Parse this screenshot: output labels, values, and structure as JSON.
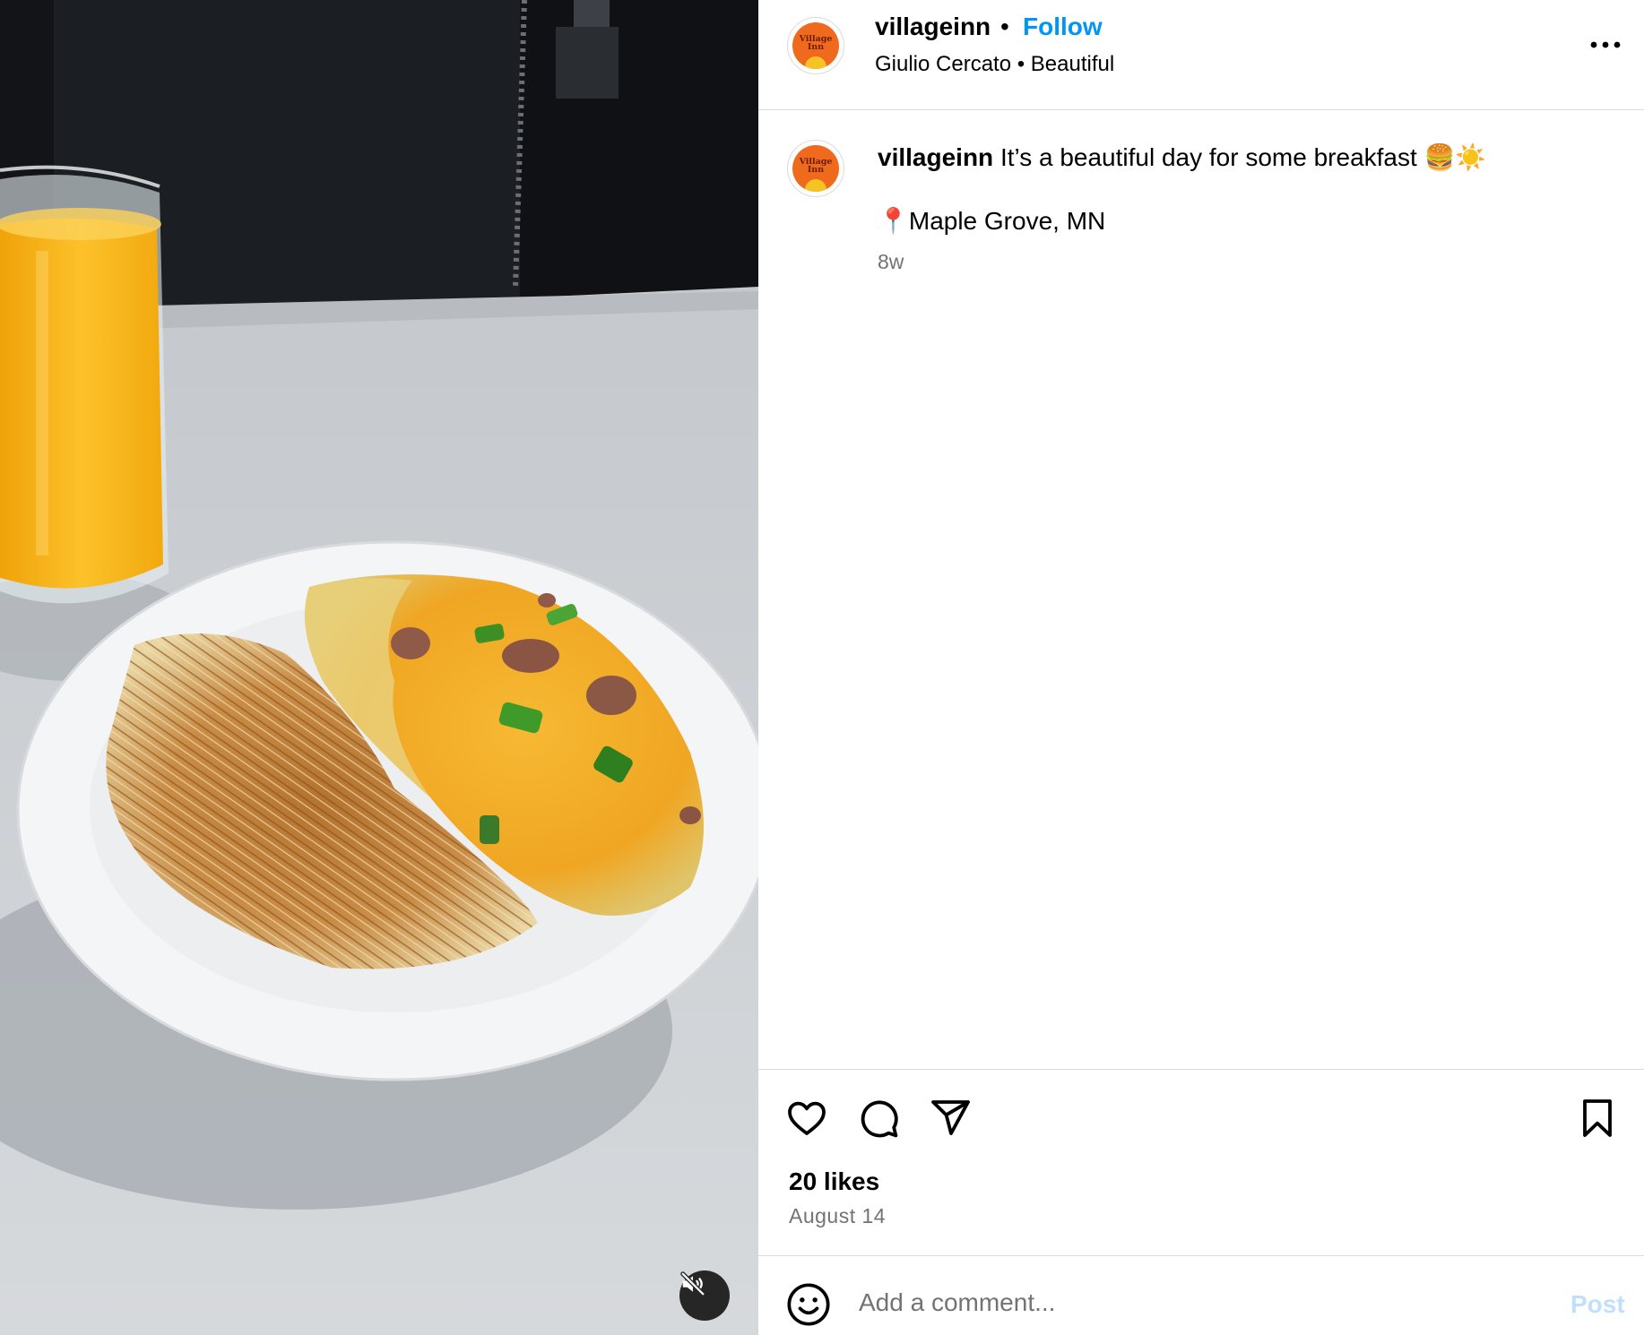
{
  "post": {
    "username": "villageinn",
    "follow_label": "Follow",
    "separator": "•",
    "audio": "Giulio Cercato • Beautiful",
    "avatar_logo_text": "Village Inn"
  },
  "caption": {
    "username": "villageinn",
    "text": "It’s a beautiful day for some breakfast 🍔☀️",
    "location": "📍Maple Grove, MN",
    "time_ago": "8w"
  },
  "engagement": {
    "likes": "20 likes",
    "date": "August 14"
  },
  "comment": {
    "placeholder": "Add a comment...",
    "post_label": "Post"
  },
  "icons": {
    "more": "more-options-icon",
    "like": "heart-icon",
    "comment": "comment-bubble-icon",
    "share": "paper-plane-icon",
    "save": "bookmark-icon",
    "emoji": "emoji-smiley-icon",
    "mute": "speaker-muted-icon"
  },
  "colors": {
    "follow": "#0095f6",
    "post_disabled": "#c0dffd",
    "secondary_text": "#737373",
    "brand_orange": "#f06a1d"
  }
}
